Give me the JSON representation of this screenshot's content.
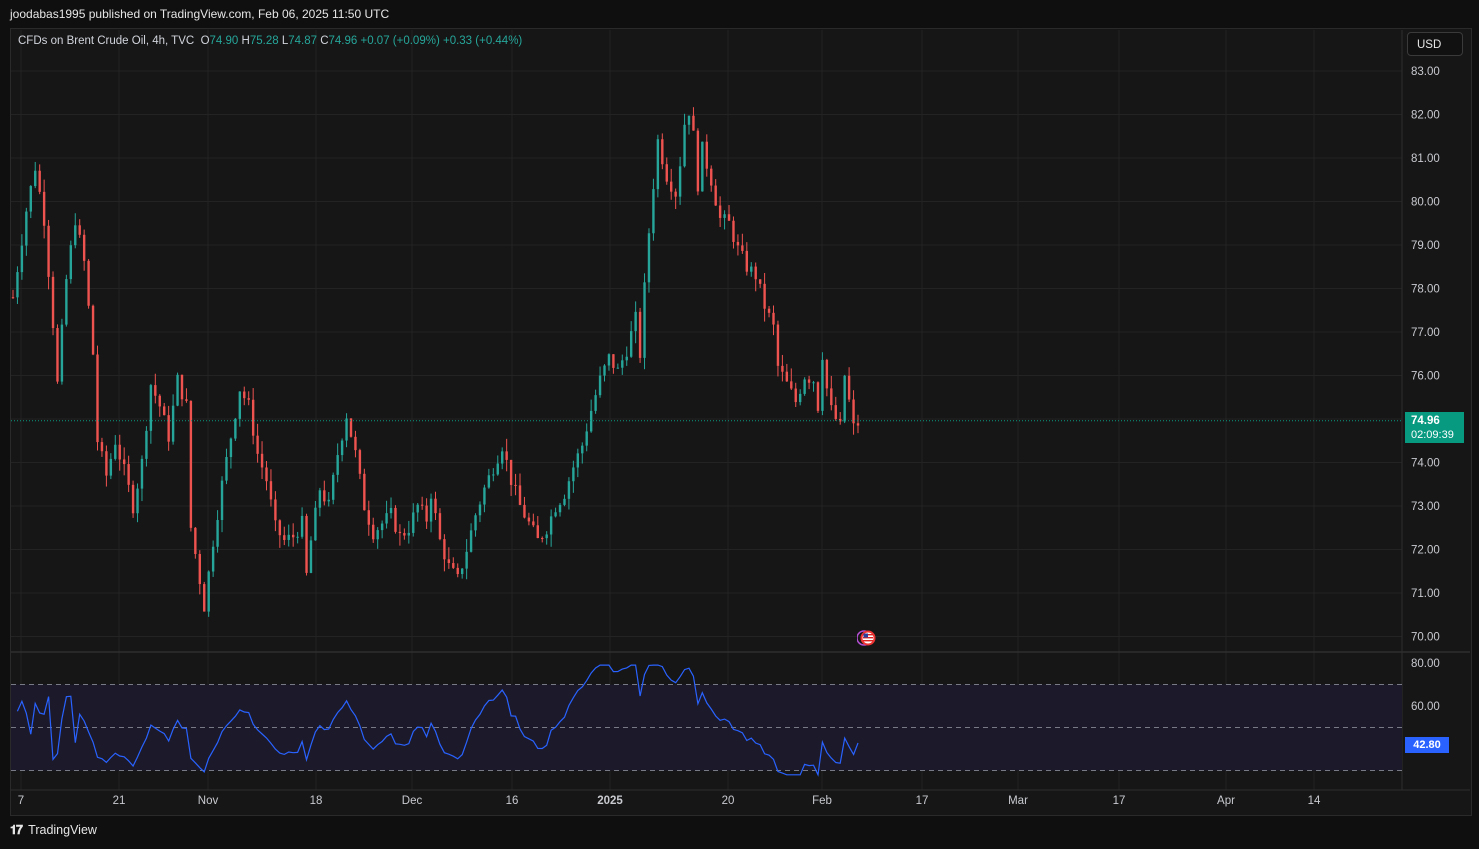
{
  "header": {
    "published": "joodabas1995 published on TradingView.com, Feb 06, 2025 11:50 UTC"
  },
  "legend": {
    "symbol": "CFDs on Brent Crude Oil, 4h, TVC",
    "o_label": "O",
    "o_value": "74.90",
    "h_label": "H",
    "h_value": "75.28",
    "l_label": "L",
    "l_value": "74.87",
    "c_label": "C",
    "c_value": "74.96",
    "change": "+0.07 (+0.09%)",
    "change2": "+0.33 (+0.44%)"
  },
  "currency_button": "USD",
  "last_price": {
    "value": "74.96",
    "countdown": "02:09:39"
  },
  "rsi_last": "42.80",
  "footer": {
    "brand": "TradingView"
  },
  "colors": {
    "up": "#26a69a",
    "down": "#ef5350",
    "rsi_line": "#2962ff",
    "rsi_band": "#1c1a2a",
    "price_tag": "#089981",
    "grid": "#232323"
  },
  "chart_data": {
    "type": "candlestick",
    "timeframe": "4h",
    "price_axis": {
      "ticks": [
        "83.00",
        "82.00",
        "81.00",
        "80.00",
        "79.00",
        "78.00",
        "77.00",
        "76.00",
        "75.00",
        "74.00",
        "73.00",
        "72.00",
        "71.00",
        "70.00"
      ],
      "range": [
        69.7,
        83.3
      ]
    },
    "time_axis": {
      "ticks": [
        "7",
        "21",
        "Nov",
        "18",
        "Dec",
        "16",
        "2025",
        "20",
        "Feb",
        "17",
        "Mar",
        "17",
        "Apr",
        "14"
      ]
    },
    "price_path": [
      [
        0,
        77.8
      ],
      [
        3,
        79.8
      ],
      [
        5,
        80.8
      ],
      [
        7,
        79.6
      ],
      [
        9,
        77.2
      ],
      [
        10,
        75.8
      ],
      [
        12,
        78.2
      ],
      [
        14,
        79.6
      ],
      [
        16,
        78.6
      ],
      [
        18,
        76.5
      ],
      [
        19,
        74.5
      ],
      [
        21,
        73.7
      ],
      [
        23,
        74.5
      ],
      [
        25,
        73.8
      ],
      [
        27,
        73.0
      ],
      [
        29,
        74.0
      ],
      [
        31,
        75.8
      ],
      [
        33,
        75.3
      ],
      [
        35,
        74.6
      ],
      [
        37,
        75.9
      ],
      [
        39,
        75.3
      ],
      [
        40,
        72.5
      ],
      [
        42,
        71.3
      ],
      [
        43,
        70.7
      ],
      [
        45,
        72.2
      ],
      [
        47,
        73.5
      ],
      [
        49,
        74.6
      ],
      [
        51,
        75.7
      ],
      [
        53,
        75.3
      ],
      [
        55,
        74.2
      ],
      [
        57,
        73.6
      ],
      [
        59,
        72.5
      ],
      [
        61,
        72.2
      ],
      [
        63,
        72.3
      ],
      [
        65,
        72.6
      ],
      [
        66,
        71.4
      ],
      [
        67,
        72.2
      ],
      [
        69,
        73.4
      ],
      [
        71,
        73.0
      ],
      [
        73,
        74.2
      ],
      [
        75,
        75.1
      ],
      [
        77,
        74.2
      ],
      [
        79,
        73.0
      ],
      [
        81,
        72.4
      ],
      [
        83,
        72.6
      ],
      [
        85,
        72.8
      ],
      [
        87,
        72.3
      ],
      [
        89,
        72.5
      ],
      [
        91,
        73.0
      ],
      [
        93,
        72.7
      ],
      [
        94,
        73.3
      ],
      [
        96,
        72.2
      ],
      [
        98,
        71.6
      ],
      [
        100,
        71.3
      ],
      [
        102,
        72.0
      ],
      [
        104,
        72.8
      ],
      [
        106,
        73.4
      ],
      [
        108,
        73.9
      ],
      [
        110,
        74.4
      ],
      [
        112,
        73.6
      ],
      [
        114,
        73.0
      ],
      [
        116,
        72.6
      ],
      [
        118,
        72.2
      ],
      [
        120,
        72.5
      ],
      [
        122,
        73.0
      ],
      [
        124,
        73.3
      ],
      [
        126,
        73.9
      ],
      [
        128,
        74.4
      ],
      [
        130,
        75.2
      ],
      [
        132,
        75.9
      ],
      [
        134,
        76.4
      ],
      [
        136,
        76.1
      ],
      [
        138,
        76.6
      ],
      [
        140,
        77.3
      ],
      [
        141,
        76.5
      ],
      [
        142,
        78.0
      ],
      [
        143,
        79.3
      ],
      [
        144,
        80.4
      ],
      [
        145,
        81.4
      ],
      [
        147,
        80.6
      ],
      [
        149,
        80.2
      ],
      [
        150,
        80.9
      ],
      [
        151,
        81.8
      ],
      [
        152,
        82.1
      ],
      [
        153,
        81.5
      ],
      [
        154,
        80.4
      ],
      [
        155,
        81.2
      ],
      [
        157,
        80.5
      ],
      [
        159,
        79.6
      ],
      [
        161,
        79.5
      ],
      [
        163,
        78.9
      ],
      [
        165,
        78.5
      ],
      [
        167,
        78.3
      ],
      [
        169,
        77.6
      ],
      [
        171,
        77.1
      ],
      [
        172,
        76.2
      ],
      [
        174,
        75.8
      ],
      [
        176,
        75.4
      ],
      [
        178,
        76.0
      ],
      [
        180,
        75.9
      ],
      [
        181,
        75.3
      ],
      [
        182,
        76.5
      ],
      [
        183,
        75.7
      ],
      [
        184,
        75.2
      ],
      [
        186,
        74.8
      ],
      [
        187,
        76.0
      ],
      [
        188,
        75.4
      ],
      [
        189,
        74.8
      ],
      [
        190,
        74.9
      ]
    ],
    "rsi": {
      "period": 14,
      "upper_band": 70,
      "middle_band": 50,
      "lower_band": 30,
      "axis_ticks": [
        "80.00",
        "60.00",
        "40.00"
      ],
      "last": 42.8
    }
  }
}
